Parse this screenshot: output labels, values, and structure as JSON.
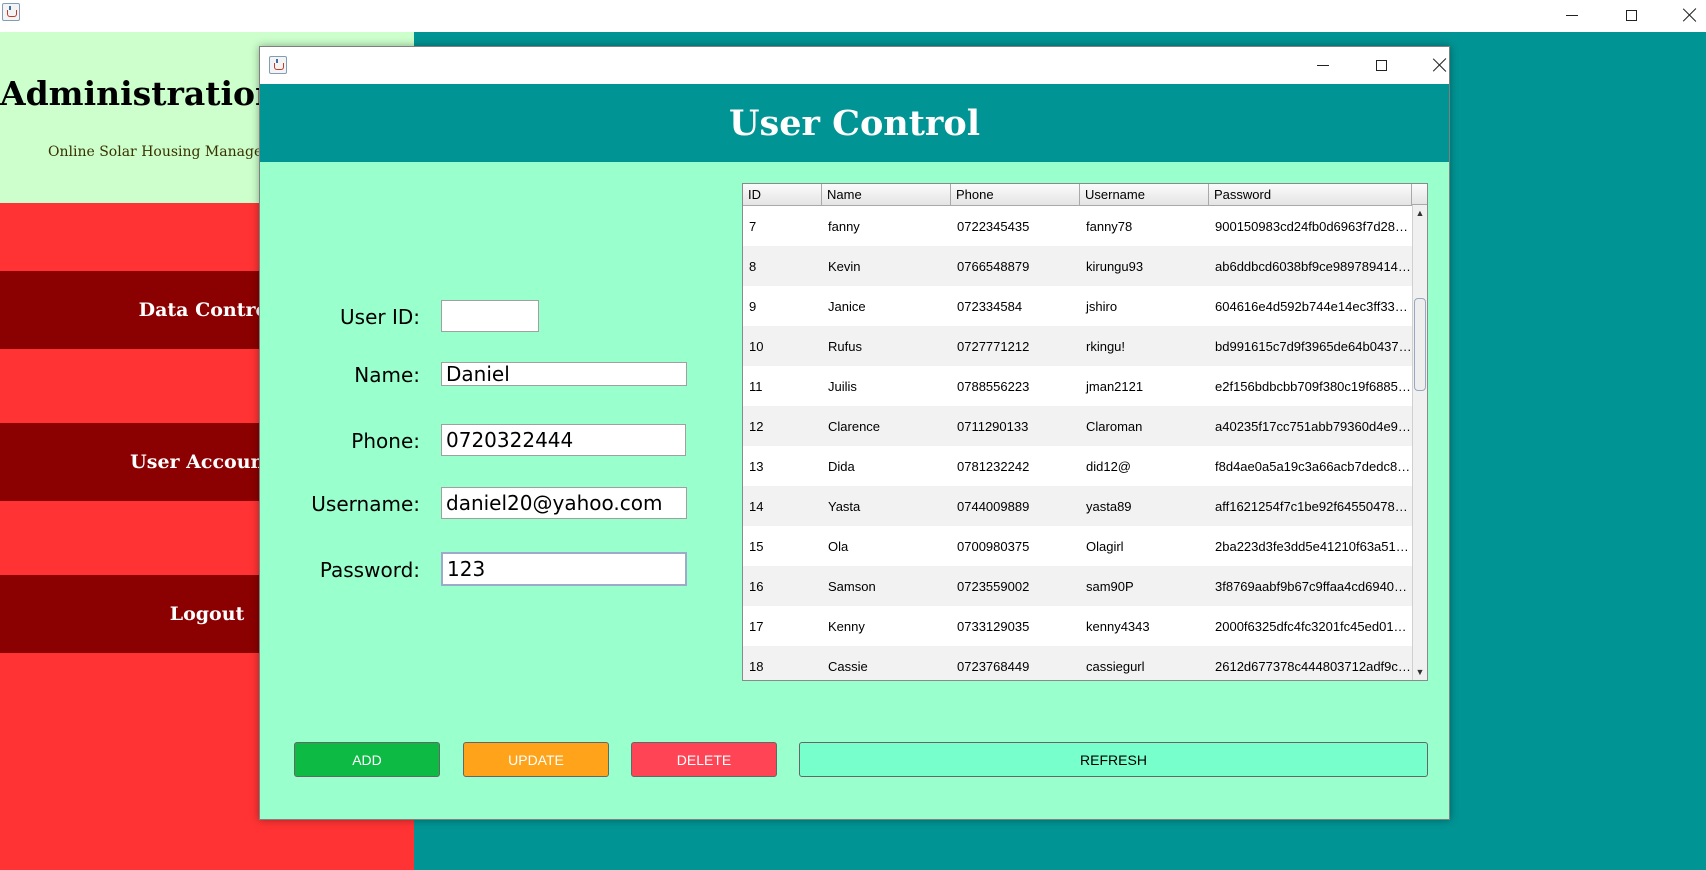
{
  "main_window": {
    "title": "",
    "sidebar": {
      "title": "Administration",
      "subtitle": "Online Solar Housing Management",
      "items": [
        {
          "label": "Data Control"
        },
        {
          "label": "User Accounts"
        },
        {
          "label": "Logout"
        }
      ]
    }
  },
  "dialog": {
    "title": "",
    "header": "User Control",
    "form": {
      "user_id": {
        "label": "User ID:",
        "value": ""
      },
      "name": {
        "label": "Name:",
        "value": "Daniel"
      },
      "phone": {
        "label": "Phone:",
        "value": "0720322444"
      },
      "username": {
        "label": "Username:",
        "value": "daniel20@yahoo.com"
      },
      "password": {
        "label": "Password:",
        "value": "123"
      }
    },
    "table": {
      "columns": [
        "ID",
        "Name",
        "Phone",
        "Username",
        "Password"
      ],
      "rows": [
        [
          "7",
          "fanny",
          "0722345435",
          "fanny78",
          "900150983cd24fb0d6963f7d28e..."
        ],
        [
          "8",
          "Kevin",
          "0766548879",
          "kirungu93",
          "ab6ddbcd6038bf9ce9897894149..."
        ],
        [
          "9",
          "Janice",
          "072334584",
          "jshiro",
          "604616e4d592b744e14ec3ff332..."
        ],
        [
          "10",
          "Rufus",
          "0727771212",
          "rkingu!",
          "bd991615c7d9f3965de64b04375..."
        ],
        [
          "11",
          "Juilis",
          "0788556223",
          "jman2121",
          "e2f156bdbcbb709f380c19f6885d..."
        ],
        [
          "12",
          "Clarence",
          "0711290133",
          "Claroman",
          "a40235f17cc751abb79360d4e9e..."
        ],
        [
          "13",
          "Dida",
          "0781232242",
          "did12@",
          "f8d4ae0a5a19c3a66acb7dedc82..."
        ],
        [
          "14",
          "Yasta",
          "0744009889",
          "yasta89",
          "aff1621254f7c1be92f64550478c..."
        ],
        [
          "15",
          "Ola",
          "0700980375",
          "Olagirl",
          "2ba223d3fe3dd5e41210f63a51a..."
        ],
        [
          "16",
          "Samson",
          "0723559002",
          "sam90P",
          "3f8769aabf9b67c9ffaa4cd69404..."
        ],
        [
          "17",
          "Kenny",
          "0733129035",
          "kenny4343",
          "2000f6325dfc4fc3201fc45ed01c7..."
        ],
        [
          "18",
          "Cassie",
          "0723768449",
          "cassiegurl",
          "2612d677378c444803712adf9c1..."
        ]
      ]
    },
    "buttons": {
      "add": "ADD",
      "update": "UPDATE",
      "delete": "DELETE",
      "refresh": "REFRESH"
    }
  },
  "colors": {
    "teal": "#019494",
    "mint": "#99ffcc",
    "sidebar_header": "#ccffcc",
    "sidebar_body": "#ff3333",
    "nav_item": "#8b0000",
    "add": "#0dbb44",
    "update": "#ffa31a",
    "delete": "#ff4455",
    "refresh": "#77ffcc"
  }
}
